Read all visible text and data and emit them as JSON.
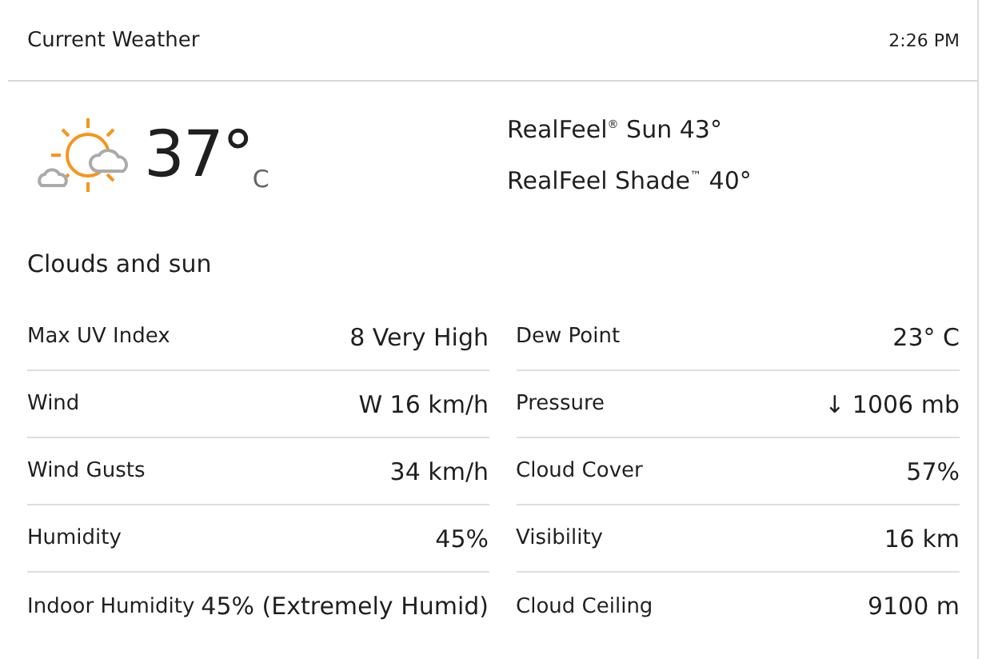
{
  "header": {
    "title": "Current Weather",
    "time": "2:26 PM"
  },
  "current": {
    "temperature": "37°",
    "unit": "C",
    "realfeel": [
      "RealFeel$^{®}$ Sun 43°",
      "RealFeel Shade$^{™}$ 40°"
    ],
    "phrase": "Clouds and sun"
  },
  "details": [
    [
      {
        "label": "Max UV Index",
        "value": "8 Very High"
      },
      {
        "label": "Wind",
        "value": "W 16 km/h"
      },
      {
        "label": "Wind Gusts",
        "value": "34 km/h"
      },
      {
        "label": "Humidity",
        "value": "45%"
      },
      {
        "label": "Indoor Humidity",
        "value": "45% (Extremely Humid)"
      }
    ],
    [
      {
        "label": "Dew Point",
        "value": "23° C"
      },
      {
        "label": "Pressure",
        "value": "↓ 1006 mb"
      },
      {
        "label": "Cloud Cover",
        "value": "57%"
      },
      {
        "label": "Visibility",
        "value": "16 km"
      },
      {
        "label": "Cloud Ceiling",
        "value": "9100 m"
      }
    ]
  ]
}
